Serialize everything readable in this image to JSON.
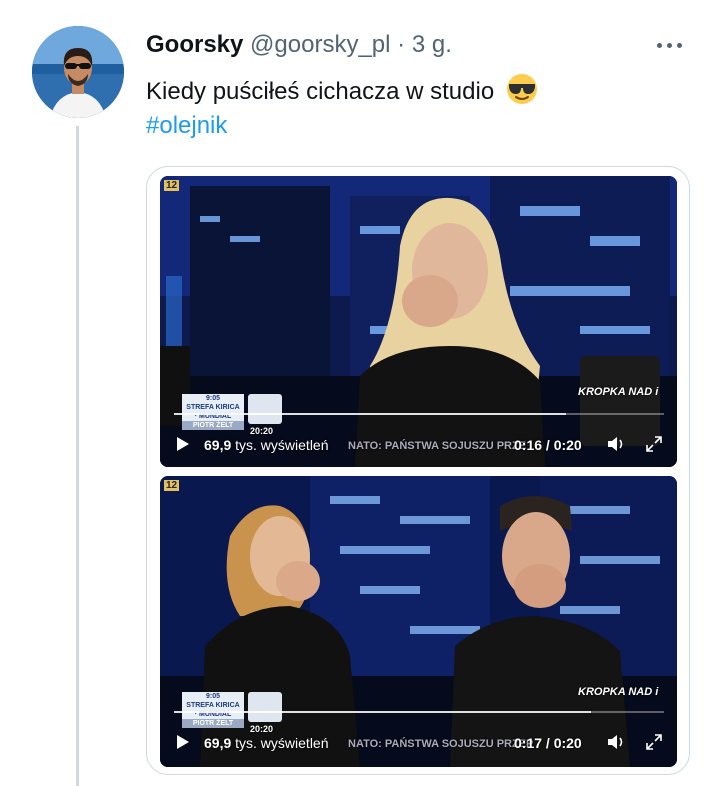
{
  "tweet": {
    "display_name": "Goorsky",
    "handle": "@goorsky_pl",
    "separator": "·",
    "time": "3 g.",
    "text": "Kiedy puściłeś cichacza w studio",
    "emoji": "smiling-face-with-sunglasses",
    "hashtag": "#olejnik"
  },
  "videos": [
    {
      "views": "69,9",
      "views_suffix": "tys. wyświetleń",
      "time": "0:16 / 0:20",
      "progress": 0.8,
      "overlay": {
        "clock": "9:05",
        "strip1": "STREFA KIRICA",
        "strip2": "· MUNDIAL",
        "strip3": "PIOTR ŻELT",
        "ticker": "NATO: PAŃSTWA SOJUSZU PRZE",
        "logo": "KROPKA NAD i",
        "channel_time": "20:20",
        "age": "12"
      }
    },
    {
      "views": "69,9",
      "views_suffix": "tys. wyświetleń",
      "time": "0:17 / 0:20",
      "progress": 0.85,
      "overlay": {
        "clock": "9:05",
        "strip1": "STREFA KIRICA",
        "strip2": "· MUNDIAL",
        "strip3": "PIOTR ŻELT",
        "ticker": "NATO: PAŃSTWA SOJUSZU PRZEP",
        "logo": "KROPKA NAD i",
        "channel_time": "20:20",
        "age": "12"
      }
    }
  ],
  "colors": {
    "accent": "#1d9bf0",
    "text": "#0f1419",
    "secondary": "#536471",
    "border": "#cfd9de"
  }
}
